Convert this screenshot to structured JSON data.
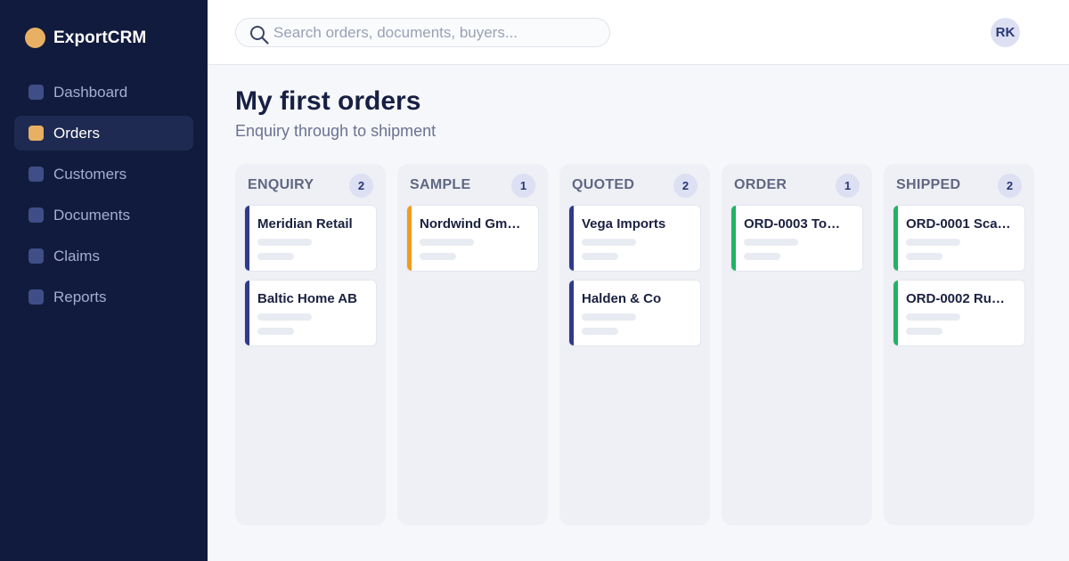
{
  "app": {
    "name": "ExportCRM",
    "brand_color": "#e7b062"
  },
  "sidebar": {
    "items": [
      {
        "label": "Dashboard",
        "icon": "dashboard-icon",
        "active": false
      },
      {
        "label": "Orders",
        "icon": "orders-icon",
        "active": true
      },
      {
        "label": "Customers",
        "icon": "customers-icon",
        "active": false
      },
      {
        "label": "Documents",
        "icon": "documents-icon",
        "active": false
      },
      {
        "label": "Claims",
        "icon": "claims-icon",
        "active": false
      },
      {
        "label": "Reports",
        "icon": "reports-icon",
        "active": false
      }
    ]
  },
  "header": {
    "search": {
      "placeholder": "Search orders, documents, buyers...",
      "value": ""
    },
    "avatar_initials": "RK"
  },
  "page": {
    "title": "My first orders",
    "subtitle": "Enquiry through to shipment"
  },
  "board": {
    "columns": [
      {
        "title": "ENQUIRY",
        "count": "2",
        "accent": "#2e3a8c",
        "cards": [
          {
            "title": "Meridian Retail"
          },
          {
            "title": "Baltic Home AB"
          }
        ]
      },
      {
        "title": "SAMPLE",
        "count": "1",
        "accent": "#f59a1b",
        "cards": [
          {
            "title": "Nordwind Gm…"
          }
        ]
      },
      {
        "title": "QUOTED",
        "count": "2",
        "accent": "#2e3a8c",
        "cards": [
          {
            "title": "Vega Imports"
          },
          {
            "title": "Halden & Co"
          }
        ]
      },
      {
        "title": "ORDER",
        "count": "1",
        "accent": "#1fb463",
        "cards": [
          {
            "title": "ORD-0003 To…"
          }
        ]
      },
      {
        "title": "SHIPPED",
        "count": "2",
        "accent": "#1fb463",
        "cards": [
          {
            "title": "ORD-0001 Sca…"
          },
          {
            "title": "ORD-0002 Ru…"
          }
        ]
      }
    ]
  }
}
